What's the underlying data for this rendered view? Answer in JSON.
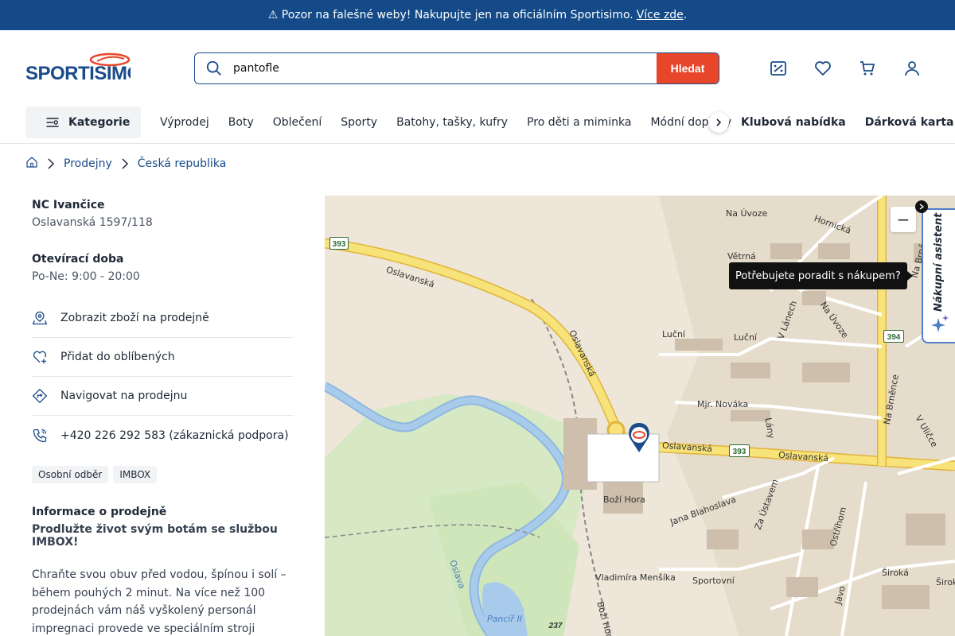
{
  "banner": {
    "text": "⚠ Pozor na falešné weby! Nakupujte jen na oficiálním Sportisimo.",
    "link": "Více zde",
    "after": "."
  },
  "header": {
    "logo_text": "SPORTISIMO",
    "search_value": "pantofle",
    "search_button": "Hledat",
    "icons": [
      "compare-icon",
      "heart-icon",
      "cart-icon",
      "user-icon"
    ]
  },
  "nav": {
    "category_label": "Kategorie",
    "items": [
      "Výprodej",
      "Boty",
      "Oblečení",
      "Sporty",
      "Batohy, tašky, kufry",
      "Pro děti a miminka",
      "Módní doplňky"
    ],
    "bold_items": [
      "Klubová nabídka",
      "Dárková karta"
    ]
  },
  "breadcrumb": [
    "Prodejny",
    "Česká republika"
  ],
  "store": {
    "name": "NC Ivančice",
    "address": "Oslavanská 1597/118",
    "hours_title": "Otevírací doba",
    "hours": "Po-Ne: 9:00 - 20:00",
    "actions": [
      {
        "label": "Zobrazit zboží na prodejně",
        "icon": "store-pin-icon"
      },
      {
        "label": "Přidat do oblíbených",
        "icon": "heart-plus-icon"
      },
      {
        "label": "Navigovat na prodejnu",
        "icon": "directions-icon"
      },
      {
        "label": "+420 226 292 583 (zákaznická podpora)",
        "icon": "phone-icon"
      }
    ],
    "tags": [
      "Osobní odběr",
      "IMBOX"
    ],
    "info_title": "Informace o prodejně",
    "info_bold": "Prodlužte život svým botám se službou IMBOX!",
    "info_text": "Chraňte svou obuv před vodou, špínou i solí – během pouhých 2 minut. Na více než 100 prodejnách vám náš vyškolený personál impregnaci provede ve speciálním stroji IMBOX, a"
  },
  "map": {
    "zoom_out": "−",
    "tooltip": "Potřebujete poradit s nákupem?",
    "assistant": "Nákupní asistent",
    "labels": [
      "Na Úvoze",
      "Hornická",
      "Větrná",
      "Oslavanská",
      "Oslavanská",
      "Oslavanská",
      "Oslavanská",
      "Luční",
      "Luční",
      "V Lánech",
      "Na Úvoze",
      "Mjr. Nováka",
      "Lány",
      "Na Brněnce",
      "V Uličce",
      "Za Ústavem",
      "Jana Blahoslava",
      "Boží Hora",
      "Vladimíra Menšíka",
      "Sportovní",
      "Ostříhom",
      "Široká",
      "Oslava",
      "Pancíř II",
      "Boží Hora",
      "Javo",
      "Široká",
      "Na Brněn"
    ],
    "road_badges": [
      "393",
      "393",
      "394",
      "237"
    ]
  }
}
